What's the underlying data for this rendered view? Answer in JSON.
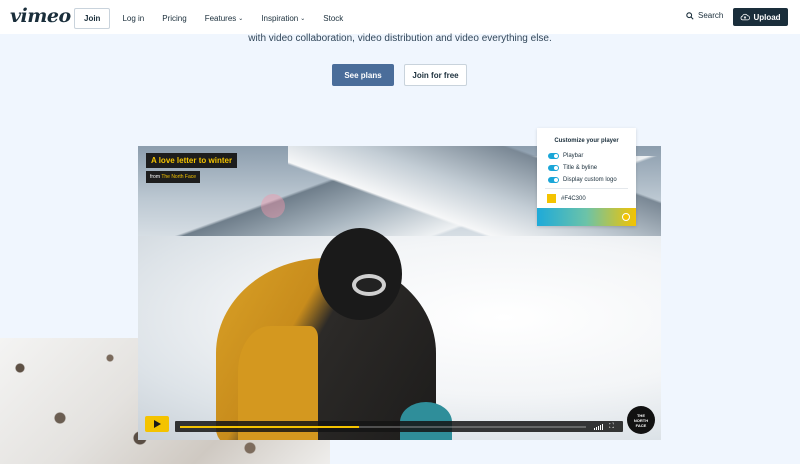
{
  "header": {
    "logo": "vimeo",
    "nav": [
      {
        "label": "Join"
      },
      {
        "label": "Log in"
      },
      {
        "label": "Pricing"
      },
      {
        "label": "Features"
      },
      {
        "label": "Inspiration"
      },
      {
        "label": "Stock"
      }
    ],
    "search_label": "Search",
    "upload_label": "Upload"
  },
  "hero": {
    "tagline": "with video collaboration, video distribution and video everything else.",
    "primary_cta": "See plans",
    "secondary_cta": "Join for free"
  },
  "player": {
    "title": "A love letter to winter",
    "byline_prefix": "from",
    "byline_author": "The North Face",
    "progress_fraction": 0.44,
    "brand_logo_text": "THE NORTH FACE",
    "accent_color": "#F4C300"
  },
  "customize_panel": {
    "title": "Customize your player",
    "options": [
      {
        "label": "Playbar",
        "enabled": true
      },
      {
        "label": "Title & byline",
        "enabled": true
      },
      {
        "label": "Display custom logo",
        "enabled": true
      }
    ],
    "color_value": "#F4C300"
  },
  "colors": {
    "brand_dark": "#1a2e3b",
    "primary_button": "#4a6d9a",
    "toggle_on": "#1aa6d8",
    "page_bg": "#f0f6fe"
  }
}
